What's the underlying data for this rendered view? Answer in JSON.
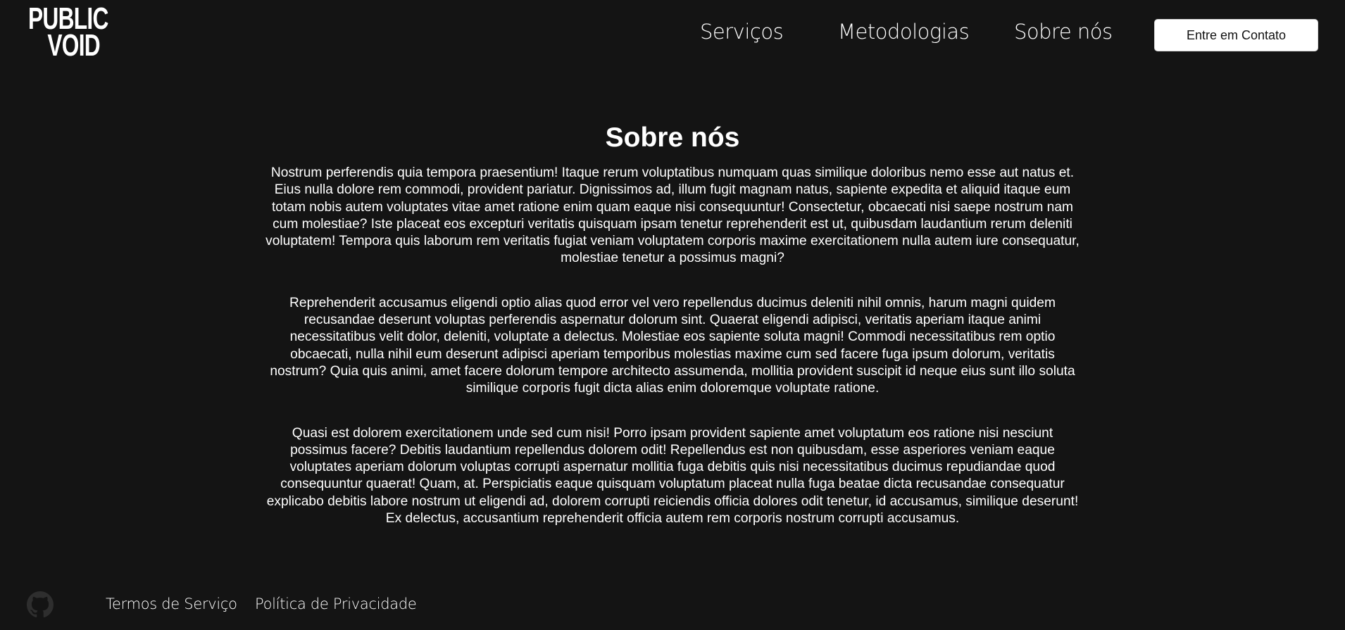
{
  "header": {
    "logo": {
      "line1": "PUBLIC",
      "line2": "VOID"
    },
    "nav": {
      "items": [
        {
          "label": "Serviços"
        },
        {
          "label": "Metodologias"
        },
        {
          "label": "Sobre nós"
        }
      ]
    },
    "contact_button": "Entre em Contato"
  },
  "main": {
    "title": "Sobre nós",
    "paragraphs": [
      "Nostrum perferendis quia tempora praesentium! Itaque rerum voluptatibus numquam quas similique doloribus nemo esse aut natus et. Eius nulla dolore rem commodi, provident pariatur. Dignissimos ad, illum fugit magnam natus, sapiente expedita et aliquid itaque eum totam nobis autem voluptates vitae amet ratione enim quam eaque nisi consequuntur! Consectetur, obcaecati nisi saepe nostrum nam cum molestiae? Iste placeat eos excepturi veritatis quisquam ipsam tenetur reprehenderit est ut, quibusdam laudantium rerum deleniti voluptatem! Tempora quis laborum rem veritatis fugiat veniam voluptatem corporis maxime exercitationem nulla autem iure consequatur, molestiae tenetur a possimus magni?",
      "Reprehenderit accusamus eligendi optio alias quod error vel vero repellendus ducimus deleniti nihil omnis, harum magni quidem recusandae deserunt voluptas perferendis aspernatur dolorum sint. Quaerat eligendi adipisci, veritatis aperiam itaque animi necessitatibus velit dolor, deleniti, voluptate a delectus. Molestiae eos sapiente soluta magni! Commodi necessitatibus rem optio obcaecati, nulla nihil eum deserunt adipisci aperiam temporibus molestias maxime cum sed facere fuga ipsum dolorum, veritatis nostrum? Quia quis animi, amet facere dolorum tempore architecto assumenda, mollitia provident suscipit id neque eius sunt illo soluta similique corporis fugit dicta alias enim doloremque voluptate ratione.",
      "Quasi est dolorem exercitationem unde sed cum nisi! Porro ipsam provident sapiente amet voluptatum eos ratione nisi nesciunt possimus facere? Debitis laudantium repellendus dolorem odit! Repellendus est non quibusdam, esse asperiores veniam eaque voluptates aperiam dolorum voluptas corrupti aspernatur mollitia fuga debitis quis nisi necessitatibus ducimus repudiandae quod consequuntur quaerat! Quam, at. Perspiciatis eaque quisquam voluptatum placeat nulla fuga beatae dicta recusandae consequatur explicabo debitis labore nostrum ut eligendi ad, dolorem corrupti reiciendis officia dolores odit tenetur, id accusamus, similique deserunt! Ex delectus, accusantium reprehenderit officia autem rem corporis nostrum corrupti accusamus."
    ]
  },
  "footer": {
    "github_icon": "github-icon",
    "links": [
      {
        "label": "Termos de Serviço"
      },
      {
        "label": "Política de Privacidade"
      }
    ]
  },
  "colors": {
    "background": "#141414",
    "text": "#ffffff",
    "button_bg": "#ffffff",
    "button_text": "#111111",
    "icon_muted": "#2e2e2e"
  }
}
